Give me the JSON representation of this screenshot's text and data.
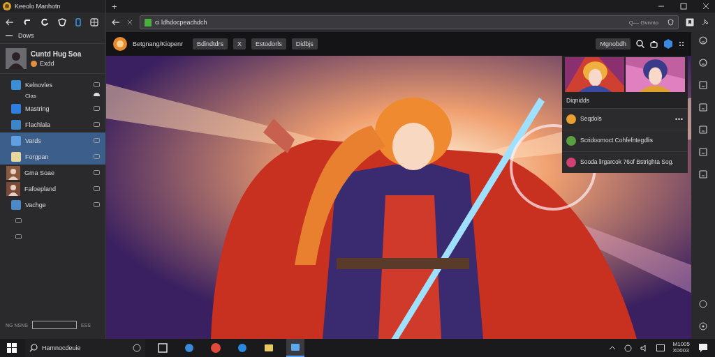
{
  "sidebar": {
    "title": "Keeolo Manhotn",
    "nav_label": "Dows",
    "profile": {
      "name": "Cuntd Hug Soa",
      "status": "Exdd"
    },
    "items": [
      {
        "label": "Kelnovles",
        "kind": "app",
        "color": "#3b8fd9",
        "selected": false,
        "note": "Cias"
      },
      {
        "label": "Mastring",
        "kind": "app",
        "color": "#2f7fe0",
        "selected": false
      },
      {
        "label": "Flachlala",
        "kind": "app",
        "color": "#3a86c8",
        "selected": false
      },
      {
        "label": "Vards",
        "kind": "app",
        "color": "#5fa0e0",
        "selected": true
      },
      {
        "label": "Forgpan",
        "kind": "app",
        "color": "#e8d8a0",
        "selected": true
      },
      {
        "label": "Gma Soae",
        "kind": "avatar",
        "color": "#8a5a40",
        "selected": false
      },
      {
        "label": "Fafoepland",
        "kind": "avatar",
        "color": "#7a4a38",
        "selected": false
      },
      {
        "label": "Vachge",
        "kind": "app",
        "color": "#4a8ac8",
        "selected": false
      }
    ],
    "footer": {
      "left": "NG NSNS",
      "right": "ESS"
    }
  },
  "browser": {
    "new_tab": "+",
    "url": "ci ldhdocpeachdch",
    "url_hint": "Q— Gvnmo"
  },
  "page": {
    "brand": "Betgnang/Kiopenr",
    "tabs": [
      {
        "label": "Bdindtdrs"
      },
      {
        "label": "X"
      },
      {
        "label": "Estodorls"
      },
      {
        "label": "Didbjs"
      }
    ],
    "action": "Mgnobdh"
  },
  "panel": {
    "caption": "Diqnidds",
    "rows": [
      {
        "text": "Seqdols",
        "color": "#e8a030",
        "more": "•••"
      },
      {
        "text": "Scridoomoct Cohfefntegdlis",
        "color": "#5aa040"
      },
      {
        "text": "Sooda lirgarcok 76of Bstrighta Sog.",
        "color": "#d04070"
      }
    ]
  },
  "taskbar": {
    "search": "Hamnocdeuie",
    "apps": [
      {
        "kind": "window",
        "selected": false
      },
      {
        "kind": "people",
        "selected": false
      },
      {
        "kind": "chrome",
        "selected": false
      },
      {
        "kind": "edge",
        "selected": false
      },
      {
        "kind": "folder",
        "selected": false
      },
      {
        "kind": "paint",
        "selected": true
      }
    ],
    "time": "M1005",
    "date": "X0003"
  }
}
